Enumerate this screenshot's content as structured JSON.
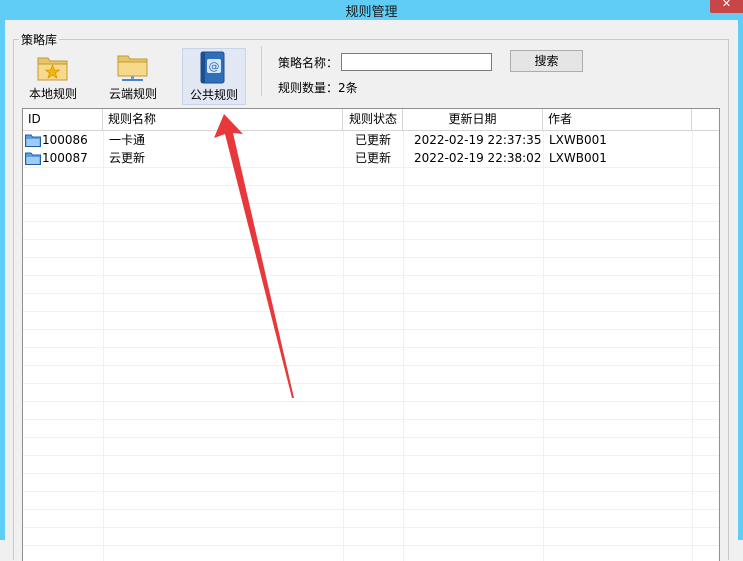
{
  "window": {
    "title": "规则管理",
    "close_symbol": "✕"
  },
  "group": {
    "legend": "策略库"
  },
  "toolbar": {
    "items": [
      {
        "label": "本地规则",
        "icon": "star-folder-icon"
      },
      {
        "label": "云端规则",
        "icon": "cloud-folder-icon"
      },
      {
        "label": "公共规则",
        "icon": "address-book-icon",
        "active": true
      }
    ]
  },
  "search": {
    "label": "策略名称：",
    "value": "",
    "button_label": "搜索",
    "count_label": "规则数量：2条"
  },
  "table": {
    "columns": [
      "ID",
      "规则名称",
      "规则状态",
      "更新日期",
      "作者"
    ],
    "rows": [
      {
        "id": "100086",
        "name": "一卡通",
        "status": "已更新",
        "date": "2022-02-19 22:37:35",
        "author": "LXWB001"
      },
      {
        "id": "100087",
        "name": "云更新",
        "status": "已更新",
        "date": "2022-02-19 22:38:02",
        "author": "LXWB001"
      }
    ]
  },
  "colors": {
    "titlebar": "#5fcdf5",
    "annotation_arrow": "#e8383b"
  }
}
